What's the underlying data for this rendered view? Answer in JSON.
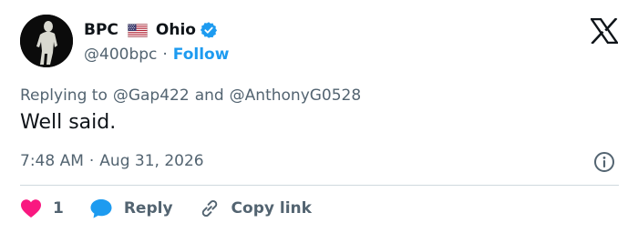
{
  "author": {
    "name_part1": "BPC",
    "name_part2": "Ohio",
    "handle": "@400bpc",
    "follow_label": "Follow",
    "separator": "·",
    "verified_color": "#1d9bf0"
  },
  "reply_context": {
    "prefix": "Replying to",
    "mention1": "@Gap422",
    "conjunction": "and",
    "mention2": "@AnthonyG0528"
  },
  "tweet": {
    "text": "Well said.",
    "time": "7:48 AM",
    "separator": "·",
    "date": "Aug 31, 2026"
  },
  "actions": {
    "like_count": "1",
    "reply_label": "Reply",
    "copy_link_label": "Copy link"
  },
  "colors": {
    "accent": "#1d9bf0",
    "like": "#f91880",
    "text": "#0f1419",
    "muted": "#536471",
    "divider": "#cfd9de"
  },
  "icons": {
    "avatar": "silhouette-figure",
    "flag": "us-flag-icon",
    "verified": "verified-badge-icon",
    "logo": "x-logo-icon",
    "info": "info-icon",
    "like": "heart-icon",
    "reply": "speech-bubble-icon",
    "copy": "link-icon"
  }
}
